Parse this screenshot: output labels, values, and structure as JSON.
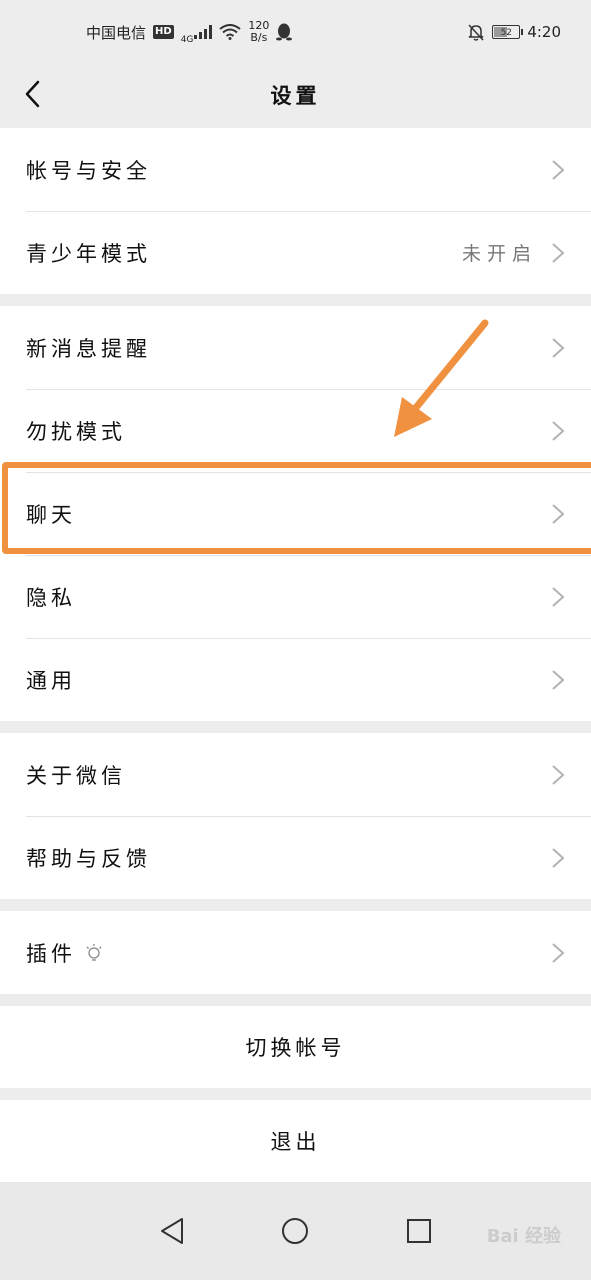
{
  "status_bar": {
    "carrier": "中国电信",
    "hd_badge": "HD",
    "network": "4G",
    "speed_value": "120",
    "speed_unit": "B/s",
    "battery_level": "52",
    "time": "4:20",
    "icons": [
      "signal-icon",
      "wifi-icon",
      "qq-penguin-icon",
      "mute-bell-icon",
      "battery-icon"
    ]
  },
  "header": {
    "title": "设置",
    "back_icon": "chevron-left-icon"
  },
  "groups": {
    "account": [
      {
        "label": "帐号与安全",
        "value": ""
      },
      {
        "label": "青少年模式",
        "value": "未开启"
      }
    ],
    "settings": [
      {
        "label": "新消息提醒"
      },
      {
        "label": "勿扰模式"
      },
      {
        "label": "聊天"
      },
      {
        "label": "隐私"
      },
      {
        "label": "通用"
      }
    ],
    "about": [
      {
        "label": "关于微信"
      },
      {
        "label": "帮助与反馈"
      }
    ],
    "plugins": [
      {
        "label": "插件",
        "icon": "lightbulb-icon"
      }
    ]
  },
  "actions": {
    "switch_account": "切换帐号",
    "logout": "退出"
  },
  "annotation": {
    "highlight_color": "#f0913f",
    "highlighted_item": "聊天"
  },
  "nav_bar": {
    "icons": [
      "back-triangle-icon",
      "home-circle-icon",
      "recents-square-icon"
    ]
  },
  "watermark": "Bai 经验"
}
